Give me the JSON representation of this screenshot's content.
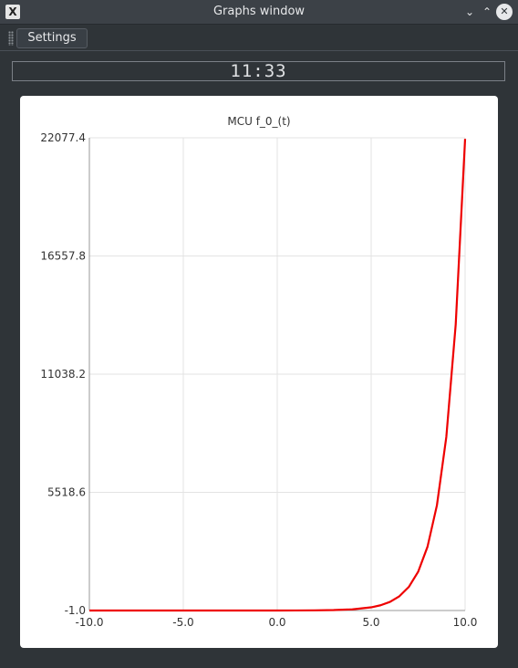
{
  "window": {
    "title": "Graphs window",
    "app_icon": "x-app-icon"
  },
  "toolbar": {
    "settings_label": "Settings"
  },
  "clock": {
    "display": "11:33"
  },
  "chart_data": {
    "type": "line",
    "title": "MCU f_0_(t)",
    "xlabel": "",
    "ylabel": "",
    "xlim": [
      -10.0,
      10.0
    ],
    "ylim": [
      -1.0,
      22077.4
    ],
    "x_ticks": [
      -10.0,
      -5.0,
      0.0,
      5.0,
      10.0
    ],
    "x_tick_labels": [
      "-10.0",
      "-5.0",
      "0.0",
      "5.0",
      "10.0"
    ],
    "y_ticks": [
      -1.0,
      5518.6,
      11038.2,
      16557.8,
      22077.4
    ],
    "y_tick_labels": [
      "-1.0",
      "5518.6",
      "11038.2",
      "16557.8",
      "22077.4"
    ],
    "grid": true,
    "series": [
      {
        "color": "#ee0000",
        "x": [
          -10,
          -8,
          -6,
          -4,
          -2,
          0,
          1,
          2,
          3,
          4,
          5,
          5.5,
          6,
          6.5,
          7,
          7.5,
          8,
          8.5,
          9,
          9.5,
          10
        ],
        "y": [
          -1.0,
          -1.0,
          -1.0,
          -1.0,
          -0.9,
          0.0,
          1.7,
          6.4,
          19.1,
          53.6,
          147.4,
          243.7,
          402.4,
          664.1,
          1095.6,
          1807.0,
          2979.9,
          4913.8,
          8102.1,
          13358.7,
          22025.5
        ]
      }
    ]
  }
}
